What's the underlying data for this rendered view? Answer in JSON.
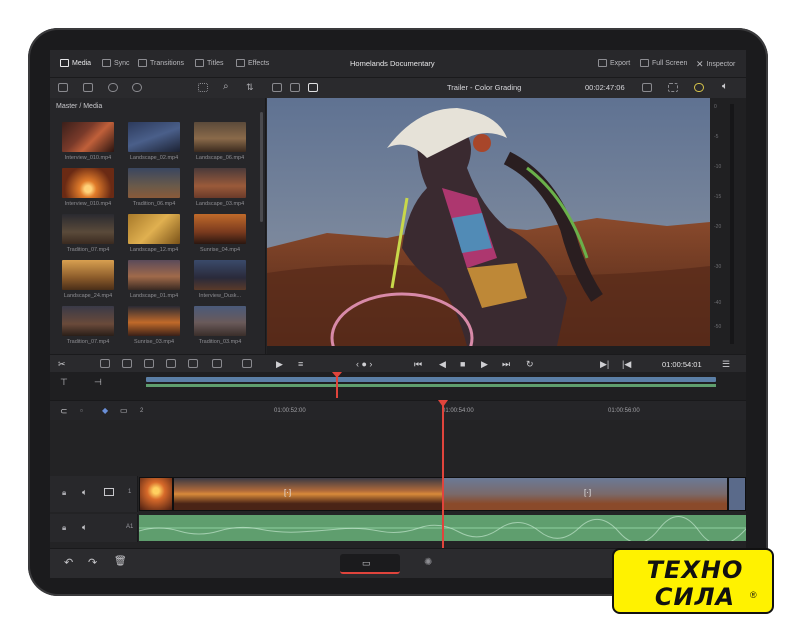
{
  "topbar": {
    "media": "Media",
    "sync": "Sync",
    "transitions": "Transitions",
    "titles": "Titles",
    "effects": "Effects",
    "project_title": "Homelands Documentary",
    "export": "Export",
    "full_screen": "Full Screen",
    "inspector": "Inspector"
  },
  "viewer": {
    "clip_title": "Trailer - Color Grading",
    "timecode": "00:02:47:06"
  },
  "media": {
    "breadcrumb": "Master / Media",
    "items": [
      {
        "label": "Interview_010.mp4"
      },
      {
        "label": "Landscape_02.mp4"
      },
      {
        "label": "Landscape_06.mp4"
      },
      {
        "label": "Interview_010.mp4"
      },
      {
        "label": "Tradition_06.mp4"
      },
      {
        "label": "Landscape_03.mp4"
      },
      {
        "label": "Tradition_07.mp4"
      },
      {
        "label": "Landscape_12.mp4"
      },
      {
        "label": "Sunrise_04.mp4"
      },
      {
        "label": "Landscape_24.mp4"
      },
      {
        "label": "Landscape_01.mp4"
      },
      {
        "label": "Interview_Dusk..."
      },
      {
        "label": "Tradition_07.mp4"
      },
      {
        "label": "Sunrise_03.mp4"
      },
      {
        "label": "Tradition_03.mp4"
      }
    ]
  },
  "meters": {
    "ticks": [
      "0",
      "-5",
      "-10",
      "-15",
      "-20",
      "-30",
      "-40",
      "-50"
    ]
  },
  "transport": {
    "timecode": "01:00:54:01"
  },
  "timeline": {
    "ruler": [
      "2",
      "01:00:52:00",
      "01:00:54:00",
      "01:00:56:00"
    ],
    "video_track_num": "1",
    "audio_track_label": "A1"
  },
  "logo": {
    "line1": "ТЕХНО",
    "line2": "СИЛА",
    "mark": "®"
  }
}
